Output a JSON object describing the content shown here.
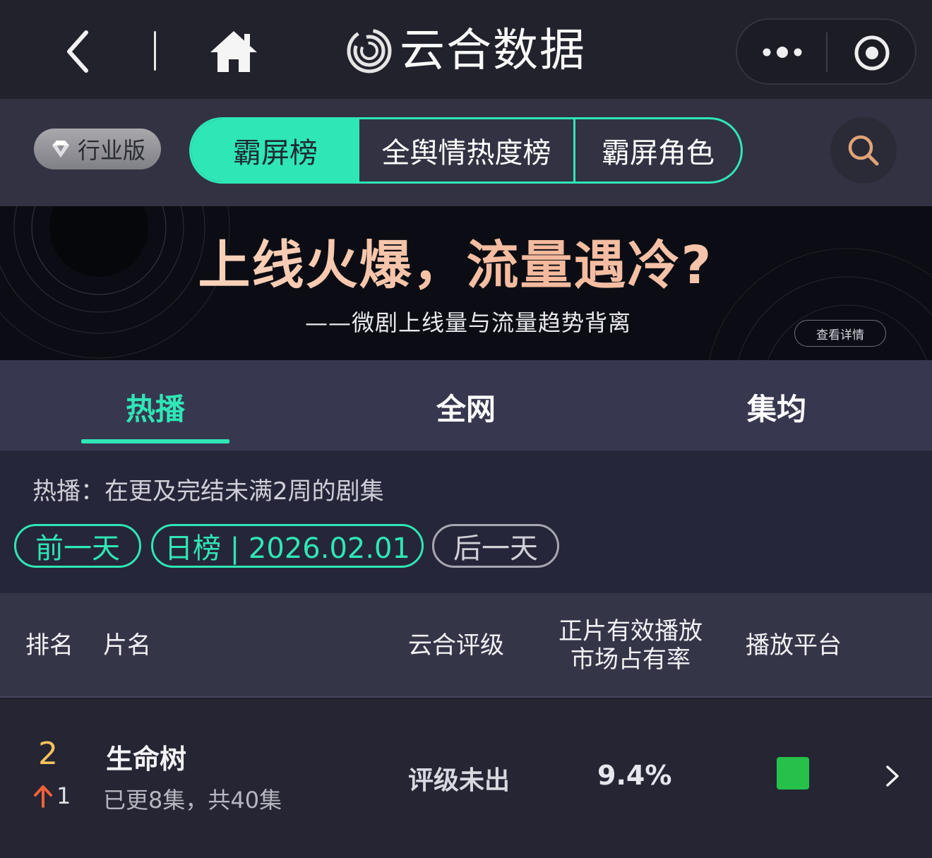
{
  "app": {
    "title": "云合数据"
  },
  "header": {
    "edition_label": "行业版",
    "segments": [
      "霸屏榜",
      "全舆情热度榜",
      "霸屏角色"
    ],
    "active_segment": 0
  },
  "banner": {
    "title": "上线火爆，流量遇冷?",
    "subtitle": "——微剧上线量与流量趋势背离",
    "cta_label": "查看详情"
  },
  "tabs": {
    "items": [
      "热播",
      "全网",
      "集均"
    ],
    "active": 0
  },
  "filters": {
    "description": "热播：在更及完结未满2周的剧集",
    "prev_label": "前一天",
    "date_label": "日榜 | 2026.02.01",
    "next_label": "后一天"
  },
  "table": {
    "headers": {
      "rank": "排名",
      "name": "片名",
      "rating": "云合评级",
      "share_line1": "正片有效播放",
      "share_line2": "市场占有率",
      "platform": "播放平台"
    },
    "rows": [
      {
        "rank": "2",
        "rank_change": "1",
        "rank_change_direction": "up",
        "title": "生命树",
        "episodes": "已更8集，共40集",
        "rating": "评级未出",
        "share": "9.4%",
        "platform_icon": "green-platform-icon",
        "platform_color": "#25c14a"
      }
    ]
  },
  "colors": {
    "accent": "#2fe6b6",
    "rank_highlight": "#f6c25e",
    "up_arrow": "#f0623a"
  }
}
